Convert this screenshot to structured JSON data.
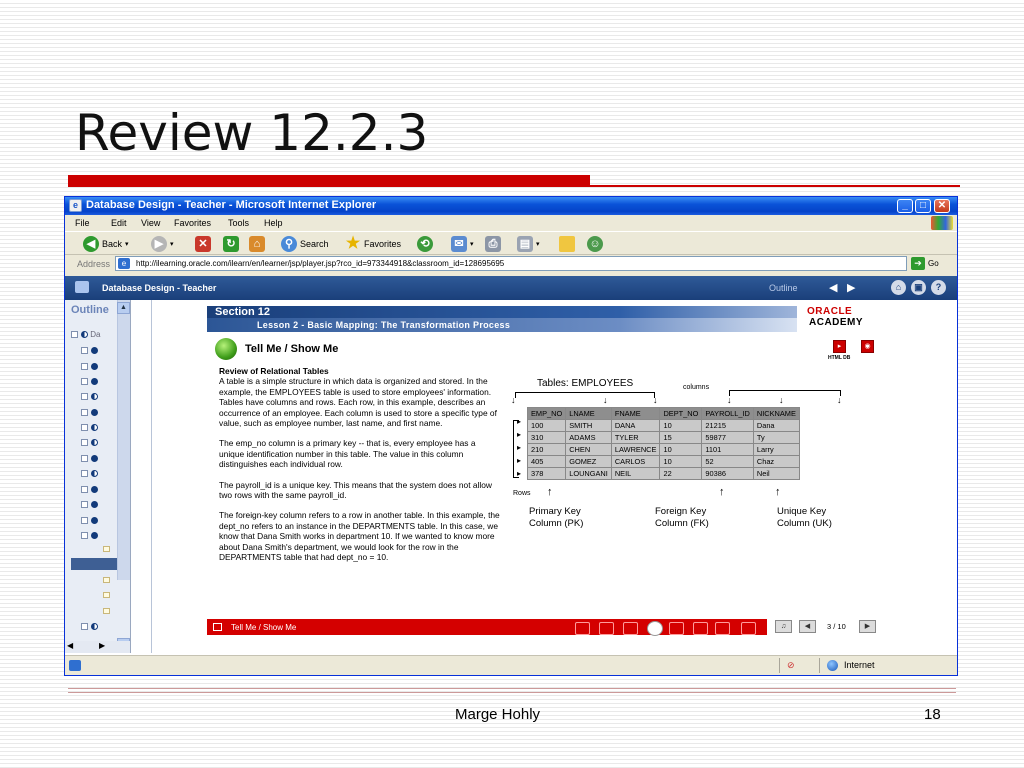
{
  "slide": {
    "title": "Review 12.2.3",
    "footer_author": "Marge Hohly",
    "footer_page": "18",
    "accent_color": "#cc0000"
  },
  "ie": {
    "window_title": "Database Design - Teacher - Microsoft Internet Explorer",
    "menu": [
      "File",
      "Edit",
      "View",
      "Favorites",
      "Tools",
      "Help"
    ],
    "toolbar": {
      "back": "Back",
      "search": "Search",
      "favorites": "Favorites"
    },
    "address_label": "Address",
    "address_url": "http://ilearning.oracle.com/ilearn/en/learner/jsp/player.jsp?rco_id=973344918&classroom_id=128695695",
    "go_label": "Go",
    "status_zone": "Internet",
    "titlebar_color": "#0a53d8"
  },
  "player": {
    "title": "Database Design - Teacher",
    "outline_label": "Outline",
    "outline_panel_title": "Outline",
    "outline_first_node": "Da"
  },
  "lesson": {
    "section": "Section 12",
    "lesson_title": "Lesson 2 - Basic Mapping: The Transformation Process",
    "logo_top": "ORACLE",
    "logo_bottom": "ACADEMY",
    "html_label": "HTML DB",
    "tell_title": "Tell Me / Show Me",
    "review_heading": "Review of Relational Tables",
    "paragraphs": [
      "A table is a simple structure in which data is organized and stored. In the example, the EMPLOYEES table is used to store employees' information. Tables have columns and rows. Each row, in this example, describes an occurrence of an employee. Each column is used to store a specific type of value, such as employee number, last name, and first name.",
      "The emp_no column is a primary key -- that is, every employee has a unique identification number in this table. The value in this column distinguishes each individual row.",
      "The payroll_id is a unique key. This means that the system does not allow two rows with the same payroll_id.",
      "The foreign-key column refers to a row in another table. In this example, the dept_no refers to an instance in the DEPARTMENTS table. In this case, we know that Dana Smith works in department 10. If we wanted to know more about Dana Smith's department, we would look for the row in the DEPARTMENTS table that had dept_no = 10."
    ],
    "table_caption": "Tables: EMPLOYEES",
    "columns_caption": "columns",
    "rows_caption": "Rows",
    "table": {
      "headers": [
        "EMP_NO",
        "LNAME",
        "FNAME",
        "DEPT_NO",
        "PAYROLL_ID",
        "NICKNAME"
      ],
      "rows": [
        [
          "100",
          "SMITH",
          "DANA",
          "10",
          "21215",
          "Dana"
        ],
        [
          "310",
          "ADAMS",
          "TYLER",
          "15",
          "59877",
          "Ty"
        ],
        [
          "210",
          "CHEN",
          "LAWRENCE",
          "10",
          "1101",
          "Larry"
        ],
        [
          "405",
          "GOMEZ",
          "CARLOS",
          "10",
          "52",
          "Chaz"
        ],
        [
          "378",
          "LOUNGANI",
          "NEIL",
          "22",
          "90386",
          "Neil"
        ]
      ]
    },
    "keys": {
      "pk": [
        "Primary Key",
        "Column (PK)"
      ],
      "fk": [
        "Foreign Key",
        "Column (FK)"
      ],
      "uk": [
        "Unique Key",
        "Column (UK)"
      ]
    },
    "footer_text": "Tell Me / Show Me",
    "page_counter": "3 / 10"
  }
}
